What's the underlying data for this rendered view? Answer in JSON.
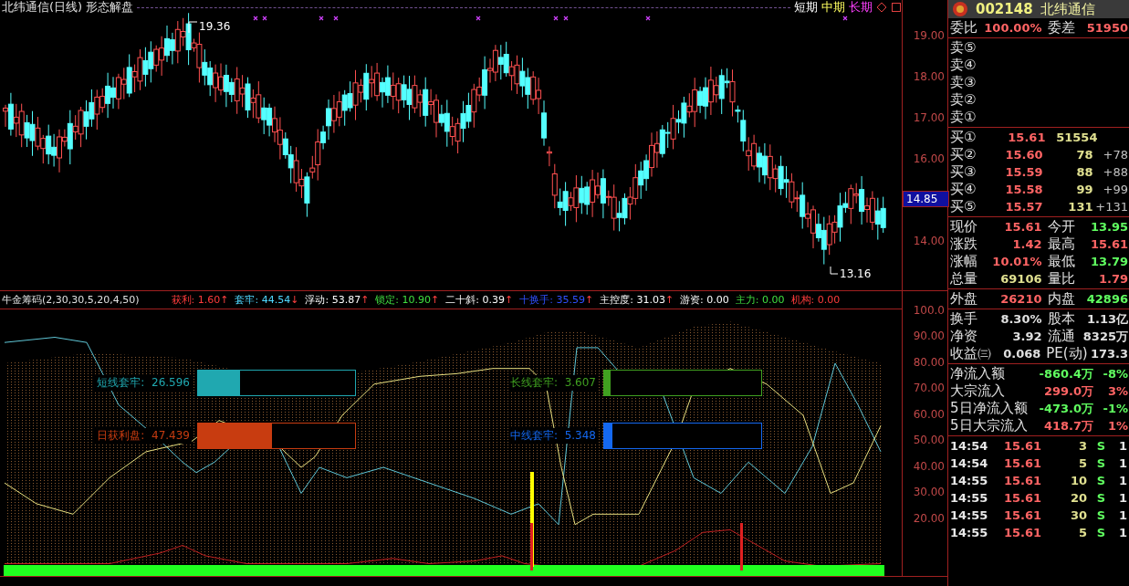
{
  "title": "北纬通信(日线) 形态解盘",
  "legend": [
    {
      "label": "短期",
      "color": "#ffffff"
    },
    {
      "label": "中期",
      "color": "#ffff60"
    },
    {
      "label": "长期",
      "color": "#ff40ff"
    }
  ],
  "price_chart": {
    "high_label": "19.36",
    "low_label": "13.16",
    "axis_ticks": [
      "19.00",
      "18.00",
      "17.00",
      "16.00",
      "14.00"
    ],
    "current_price": "14.85"
  },
  "indicator": {
    "name": "牛金筹码(2,30,30,5,20,4,50)",
    "readouts": [
      {
        "label": "获利:",
        "value": "1.60",
        "arrow": "↑",
        "color": "#ff3c3c"
      },
      {
        "label": "套牢:",
        "value": "44.54",
        "arrow": "↓",
        "color": "#50d8ff"
      },
      {
        "label": "浮动:",
        "value": "53.87",
        "arrow": "↑",
        "color": "#ffffff"
      },
      {
        "label": "锁定:",
        "value": "10.90",
        "arrow": "↑",
        "color": "#40e040"
      },
      {
        "label": "二十斜:",
        "value": "0.39",
        "arrow": "↑",
        "color": "#ffffff"
      },
      {
        "label": "十换手:",
        "value": "35.59",
        "arrow": "↑",
        "color": "#3050ff"
      },
      {
        "label": "主控度:",
        "value": "31.03",
        "arrow": "↑",
        "color": "#ffffff"
      },
      {
        "label": "游资:",
        "value": "0.00",
        "color": "#ffffff"
      },
      {
        "label": "主力:",
        "value": "0.00",
        "color": "#40e040"
      },
      {
        "label": "机构:",
        "value": "0.00",
        "color": "#ff3c3c"
      }
    ],
    "axis_ticks": [
      "100.0",
      "90.00",
      "80.00",
      "70.00",
      "60.00",
      "50.00",
      "40.00",
      "30.00",
      "20.00"
    ],
    "gauges": [
      {
        "label": "短线套牢:",
        "value": "26.596",
        "level": 0.27,
        "color": "#20a8b0"
      },
      {
        "label": "日获利盘:",
        "value": "47.439",
        "level": 0.47,
        "color": "#c83c10"
      },
      {
        "label": "长线套牢:",
        "value": "3.607",
        "level": 0.04,
        "color": "#40a020"
      },
      {
        "label": "中线套牢:",
        "value": "5.348",
        "level": 0.05,
        "color": "#1468f0"
      }
    ]
  },
  "quote": {
    "code": "002148",
    "name": "北纬通信",
    "ratio": {
      "label": "委比",
      "value": "100.00%",
      "diff_label": "委差",
      "diff": "51950"
    },
    "sells": [
      "卖⑤",
      "卖④",
      "卖③",
      "卖②",
      "卖①"
    ],
    "buys": [
      {
        "label": "买①",
        "price": "15.61",
        "volume": "51554"
      },
      {
        "label": "买②",
        "price": "15.60",
        "volume": "78",
        "change": "+78"
      },
      {
        "label": "买③",
        "price": "15.59",
        "volume": "88",
        "change": "+88"
      },
      {
        "label": "买④",
        "price": "15.58",
        "volume": "99",
        "change": "+99"
      },
      {
        "label": "买⑤",
        "price": "15.57",
        "volume": "131",
        "change": "+131"
      }
    ],
    "stats": [
      [
        {
          "label": "现价",
          "value": "15.61",
          "color": "#ff6464"
        },
        {
          "label": "今开",
          "value": "13.95",
          "color": "#60ff60"
        }
      ],
      [
        {
          "label": "涨跌",
          "value": "1.42",
          "color": "#ff6464"
        },
        {
          "label": "最高",
          "value": "15.61",
          "color": "#ff6464"
        }
      ],
      [
        {
          "label": "涨幅",
          "value": "10.01%",
          "color": "#ff6464"
        },
        {
          "label": "最低",
          "value": "13.79",
          "color": "#60ff60"
        }
      ],
      [
        {
          "label": "总量",
          "value": "69106",
          "color": "#e0e090"
        },
        {
          "label": "量比",
          "value": "1.79",
          "color": "#ff6464"
        }
      ]
    ],
    "stats2": [
      [
        {
          "label": "外盘",
          "value": "26210",
          "color": "#ff6464"
        },
        {
          "label": "内盘",
          "value": "42896",
          "color": "#60ff60"
        }
      ]
    ],
    "stats3": [
      [
        {
          "label": "换手",
          "value": "8.30%",
          "color": "#e0e0e0"
        },
        {
          "label": "股本",
          "value": "1.13亿",
          "color": "#e0e0e0"
        }
      ],
      [
        {
          "label": "净资",
          "value": "3.92",
          "color": "#e0e0e0"
        },
        {
          "label": "流通",
          "value": "8325万",
          "color": "#e0e0e0"
        }
      ],
      [
        {
          "label": "收益㈢",
          "value": "0.068",
          "color": "#e0e0e0"
        },
        {
          "label": "PE(动)",
          "value": "173.3",
          "color": "#e0e0e0"
        }
      ]
    ],
    "flows": [
      {
        "label": "净流入额",
        "amount": "-860.4万",
        "pct": "-8%",
        "color": "#60ff60"
      },
      {
        "label": "大宗流入",
        "amount": "299.0万",
        "pct": "3%",
        "color": "#ff6464"
      },
      {
        "label": "5日净流入额",
        "amount": "-473.0万",
        "pct": "-1%",
        "color": "#60ff60"
      },
      {
        "label": "5日大宗流入",
        "amount": "418.7万",
        "pct": "1%",
        "color": "#ff6464"
      }
    ],
    "ticks": [
      {
        "time": "14:54",
        "price": "15.61",
        "volume": "3",
        "side": "S",
        "count": "1"
      },
      {
        "time": "14:54",
        "price": "15.61",
        "volume": "5",
        "side": "S",
        "count": "1"
      },
      {
        "time": "14:55",
        "price": "15.61",
        "volume": "10",
        "side": "S",
        "count": "1"
      },
      {
        "time": "14:55",
        "price": "15.61",
        "volume": "20",
        "side": "S",
        "count": "1"
      },
      {
        "time": "14:55",
        "price": "15.61",
        "volume": "30",
        "side": "S",
        "count": "1"
      },
      {
        "time": "14:55",
        "price": "15.61",
        "volume": "5",
        "side": "S",
        "count": "1"
      }
    ]
  }
}
